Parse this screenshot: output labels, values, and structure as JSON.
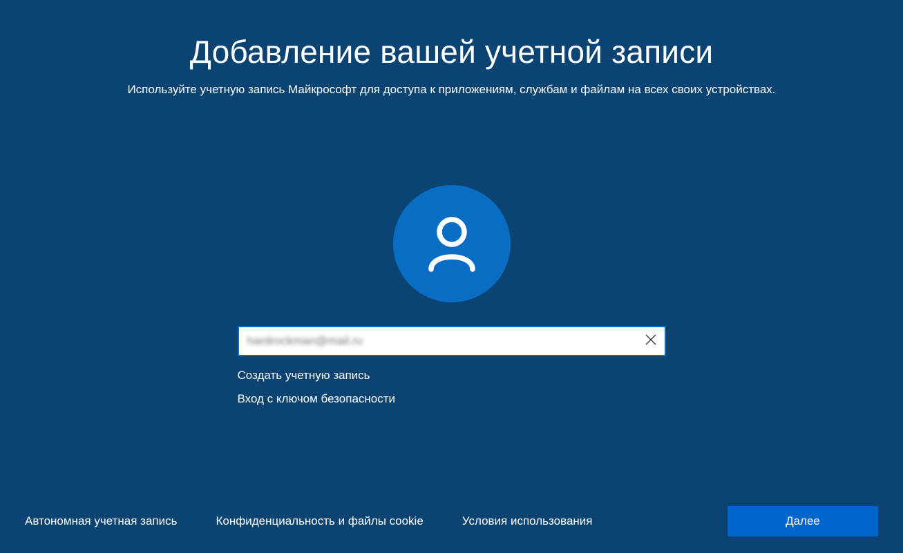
{
  "header": {
    "title": "Добавление вашей учетной записи",
    "subtitle": "Используйте учетную запись Майкрософт для доступа к приложениям, службам и файлам на всех своих устройствах."
  },
  "form": {
    "email_value": "hardrockman@mail.ru",
    "create_account_label": "Создать учетную запись",
    "security_key_label": "Вход с ключом безопасности"
  },
  "footer": {
    "offline_account": "Автономная учетная запись",
    "privacy_cookies": "Конфиденциальность и файлы cookie",
    "terms": "Условия использования",
    "next_label": "Далее"
  },
  "colors": {
    "background": "#0b4472",
    "accent": "#0a6dc4",
    "button": "#0066cc"
  }
}
